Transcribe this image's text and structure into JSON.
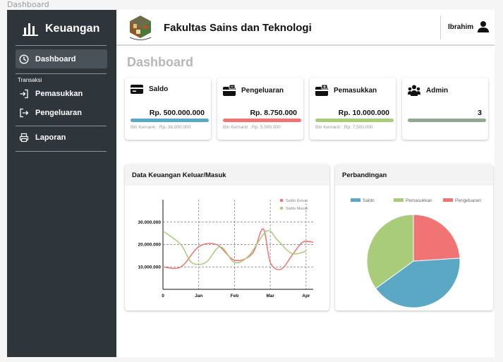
{
  "frame_label": "Dashboard",
  "sidebar": {
    "brand": "Keuangan",
    "items": [
      {
        "label": "Dashboard",
        "icon": "clock-icon"
      },
      {
        "label": "Pemasukkan",
        "icon": "login-icon"
      },
      {
        "label": "Pengeluaran",
        "icon": "logout-icon"
      },
      {
        "label": "Laporan",
        "icon": "printer-icon"
      }
    ],
    "section": "Transaksi"
  },
  "header": {
    "faculty": "Fakultas Sains dan Teknologi",
    "user": "Ibrahim"
  },
  "page_title": "Dashboard",
  "cards": [
    {
      "title": "Saldo",
      "value": "Rp. 500.000.000",
      "note": "Bln Kemarin : Rp. 36.000.000",
      "color": "#5aa8c4"
    },
    {
      "title": "Pengeluaran",
      "value": "Rp. 8.750.000",
      "note": "Bln Kemarin : Rp. 5.000.000",
      "color": "#f07474"
    },
    {
      "title": "Pemasukkan",
      "value": "Rp. 10.000.000",
      "note": "Bln Kemarin : Rp. 7.500.000",
      "color": "#a8cc7a"
    },
    {
      "title": "Admin",
      "value": "3",
      "note": "",
      "color": "#95a593"
    }
  ],
  "line_panel": {
    "title": "Data Keuangan Keluar/Masuk"
  },
  "pie_panel": {
    "title": "Perbandingan"
  },
  "chart_data": [
    {
      "type": "line",
      "title": "Data Keuangan Keluar/Masuk",
      "x_ticks": [
        "0",
        "Jan",
        "Feb",
        "Mar",
        "Apr"
      ],
      "y_ticks": [
        "10.000.000",
        "20.000.000",
        "30.000.000"
      ],
      "ylim": [
        0,
        40000000
      ],
      "grid": true,
      "legend": "top-right",
      "series": [
        {
          "name": "Saldo Keluar",
          "color": "#f07474",
          "x": [
            0,
            0.5,
            1.0,
            1.5,
            2.0,
            2.5,
            2.8,
            3.0,
            3.3,
            3.6,
            3.9,
            4.2
          ],
          "y": [
            10000000,
            10000000,
            19000000,
            20000000,
            13000000,
            16000000,
            27000000,
            12000000,
            9000000,
            15000000,
            21000000,
            21000000
          ]
        },
        {
          "name": "Saldo Masuk",
          "color": "#a8cc7a",
          "x": [
            0,
            0.5,
            0.8,
            1.2,
            1.6,
            2.0,
            2.4,
            2.9,
            3.2,
            3.6,
            4.0
          ],
          "y": [
            26000000,
            20000000,
            12000000,
            12000000,
            19000000,
            12000000,
            15000000,
            26000000,
            22000000,
            16000000,
            17000000
          ]
        }
      ]
    },
    {
      "type": "pie",
      "title": "Perbandingan",
      "legend": "top",
      "slices": [
        {
          "label": "Saldo",
          "value": 41,
          "color": "#5aa8c4"
        },
        {
          "label": "Pemasukkan",
          "value": 35,
          "color": "#a8cc7a"
        },
        {
          "label": "Pengeluaran",
          "value": 24,
          "color": "#f07474"
        }
      ]
    }
  ]
}
